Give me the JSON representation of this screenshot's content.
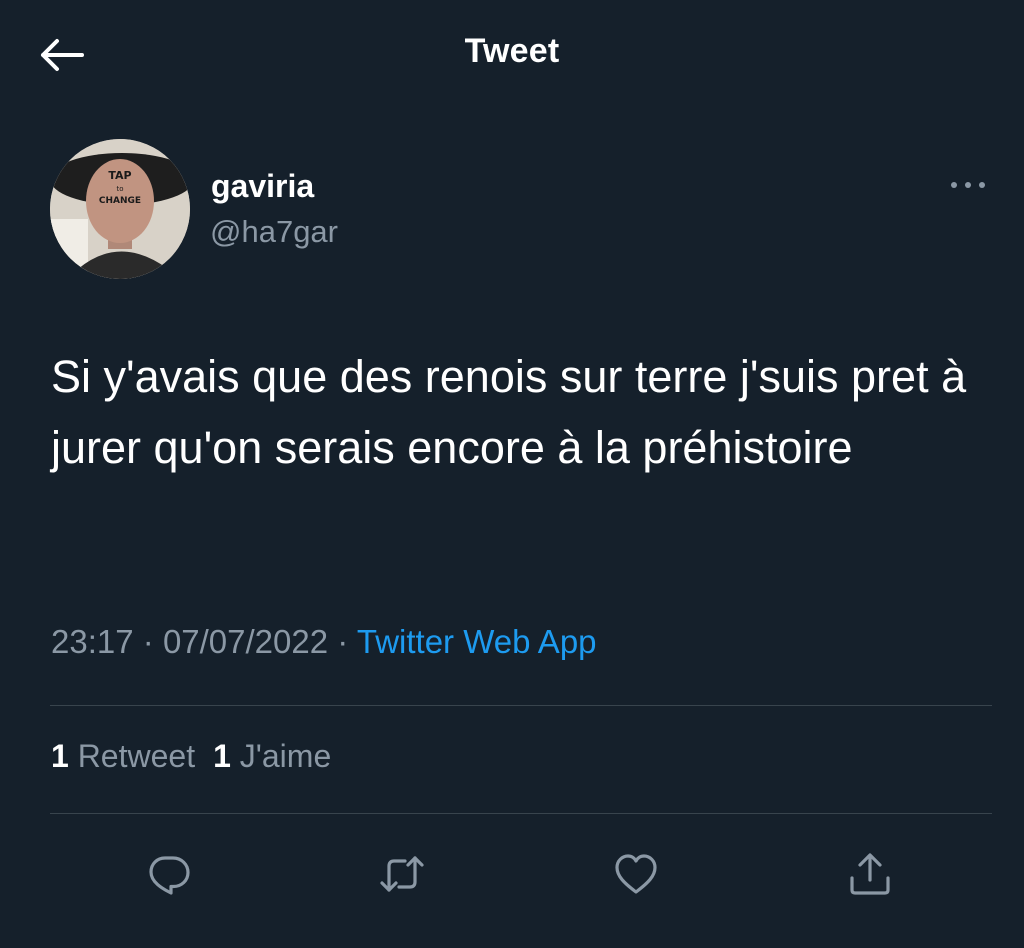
{
  "header": {
    "title": "Tweet",
    "back_icon": "arrow-left-icon"
  },
  "author": {
    "display_name": "gaviria",
    "handle": "@ha7gar",
    "avatar_text": [
      "TAP",
      "to",
      "CHANGE"
    ],
    "more_icon": "more-horizontal-icon"
  },
  "tweet": {
    "text": "Si y'avais que des renois sur terre j'suis pret à jurer qu'on serais encore à la préhistoire",
    "time": "23:17",
    "date": "07/07/2022",
    "separator": "·",
    "source": "Twitter Web App"
  },
  "stats": {
    "retweets_count": "1",
    "retweets_label": "Retweet",
    "likes_count": "1",
    "likes_label": "J'aime"
  },
  "actions": [
    {
      "name": "reply",
      "icon": "reply-icon"
    },
    {
      "name": "retweet",
      "icon": "retweet-icon"
    },
    {
      "name": "like",
      "icon": "heart-icon"
    },
    {
      "name": "share",
      "icon": "share-icon"
    }
  ],
  "colors": {
    "background": "#15202b",
    "text_primary": "#ffffff",
    "text_secondary": "#8b98a5",
    "accent": "#1d9bf0",
    "divider": "#38444d"
  }
}
